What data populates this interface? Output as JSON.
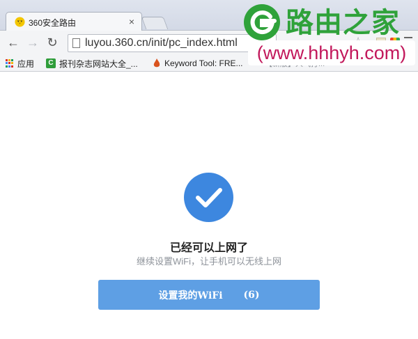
{
  "browser": {
    "tab": {
      "title": "360安全路由",
      "close": "×"
    },
    "nav": {
      "back": "←",
      "forward": "→",
      "reload": "↻"
    },
    "address": {
      "url": "luyou.360.cn/init/pc_index.html"
    },
    "bookmarks": [
      {
        "label": "应用"
      },
      {
        "label": "报刊杂志网站大全_..."
      },
      {
        "label": "Keyword Tool: FRE..."
      },
      {
        "label": "【新版】人气打..."
      }
    ],
    "star": "☆"
  },
  "watermark": {
    "title": "路由之家",
    "url": "(www.hhhyh.com)"
  },
  "page": {
    "title": "已经可以上网了",
    "subtitle": "继续设置WiFi，让手机可以无线上网",
    "button": {
      "label": "设置我的WiFi",
      "countdown": "(6)"
    }
  },
  "colors": {
    "accent": "#3d87df",
    "button": "#5e9fe4",
    "watermark_green": "#2fa23a",
    "watermark_url": "#c2185b"
  }
}
